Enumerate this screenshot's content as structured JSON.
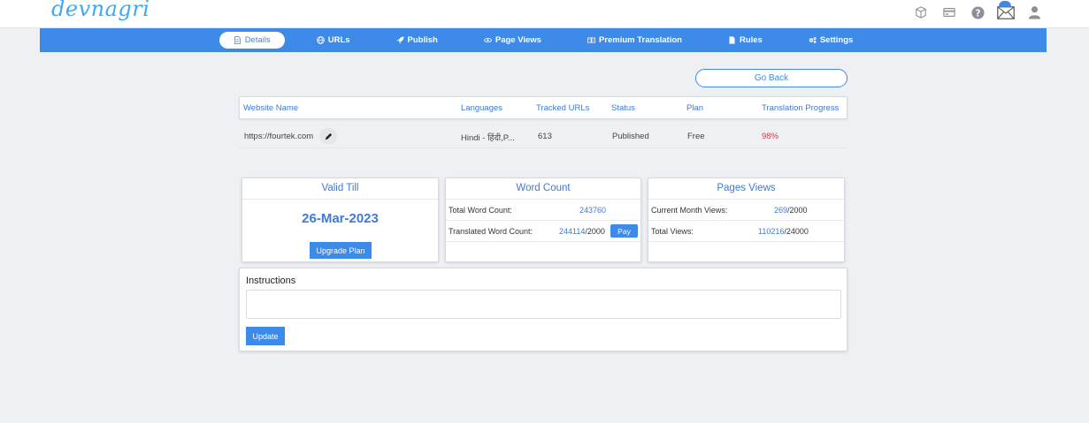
{
  "brand": {
    "logo_text": "devnagri"
  },
  "header_icons": [
    "cube-icon",
    "billing-card-icon",
    "help-icon",
    "mail-icon",
    "user-icon"
  ],
  "nav": {
    "items": [
      {
        "label": "Details",
        "icon": "document-icon",
        "active": true
      },
      {
        "label": "URLs",
        "icon": "globe-icon"
      },
      {
        "label": "Publish",
        "icon": "rocket-icon"
      },
      {
        "label": "Page Views",
        "icon": "eye-icon"
      },
      {
        "label": "Premium Translation",
        "icon": "translate-icon"
      },
      {
        "label": "Rules",
        "icon": "file-icon"
      },
      {
        "label": "Settings",
        "icon": "gears-icon"
      }
    ]
  },
  "go_back_label": "Go Back",
  "table": {
    "headers": [
      "Website Name",
      "Languages",
      "Tracked URLs",
      "Status",
      "Plan",
      "Translation Progress"
    ],
    "row": {
      "website": "https://fourtek.com",
      "languages": "Hindi - हिंदी,P...",
      "tracked_urls": "613",
      "status": "Published",
      "plan": "Free",
      "progress": "98%"
    }
  },
  "valid_till": {
    "title": "Valid Till",
    "date": "26-Mar-2023",
    "button": "Upgrade Plan"
  },
  "word_count": {
    "title": "Word Count",
    "total_label": "Total Word Count:",
    "total_value": "243760",
    "translated_label": "Translated Word Count:",
    "translated_value": "244114",
    "translated_limit": "/2000",
    "pay_label": "Pay"
  },
  "page_views": {
    "title": "Pages Views",
    "month_label": "Current Month Views:",
    "month_value": "269",
    "month_limit": "/2000",
    "total_label": "Total Views:",
    "total_value": "110216",
    "total_limit": "/24000"
  },
  "instructions": {
    "title": "Instructions",
    "value": "",
    "button": "Update"
  },
  "colors": {
    "accent": "#3d8ae8",
    "progress_red": "#e8333f",
    "background": "#eef0f3"
  }
}
